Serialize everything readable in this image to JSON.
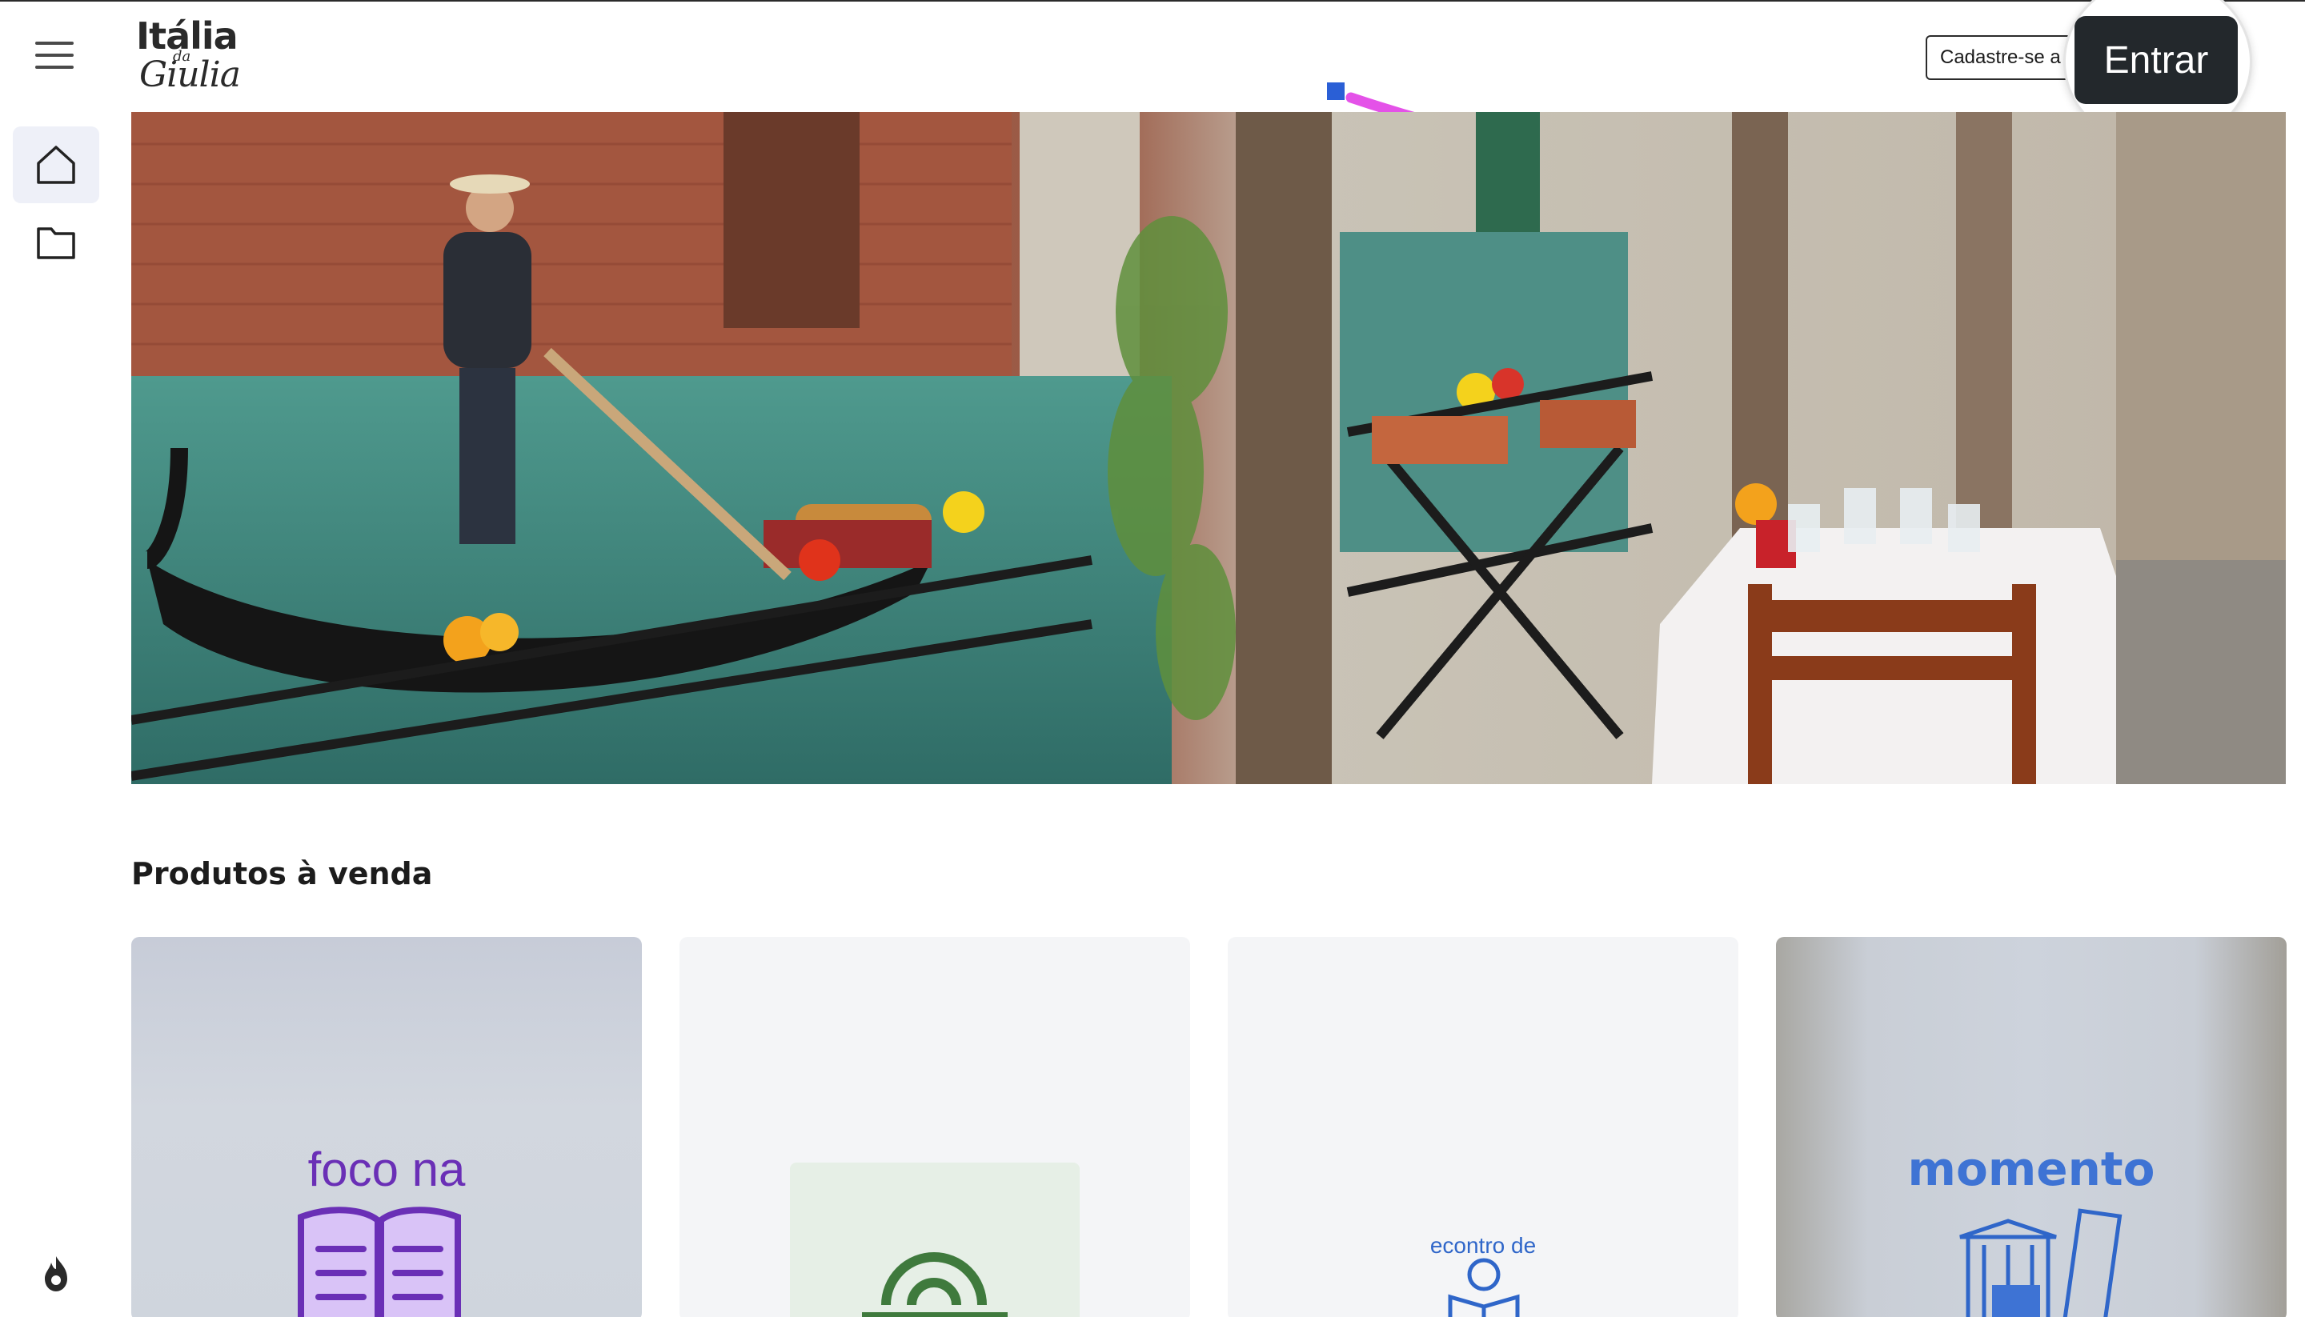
{
  "header": {
    "logo": {
      "line1": "Itália",
      "line2": "da",
      "line3": "Giulia"
    },
    "signup_label": "Cadastre-se a",
    "login_label": "Entrar"
  },
  "sidebar": {
    "items": [
      {
        "icon": "home-icon",
        "active": true
      },
      {
        "icon": "folder-icon",
        "active": false
      }
    ],
    "footer_icon": "flame-icon"
  },
  "main": {
    "section_title": "Produtos à venda",
    "products": [
      {
        "cover_text": "foco na"
      },
      {
        "cover_text": ""
      },
      {
        "cover_text": "econtro de"
      },
      {
        "cover_text": "momento"
      }
    ]
  },
  "colors": {
    "login_bg": "#23282c",
    "annotation_arrow": "#e452e8",
    "annotation_marker": "#2a5fd6",
    "sidebar_active_bg": "#eef0f8"
  }
}
